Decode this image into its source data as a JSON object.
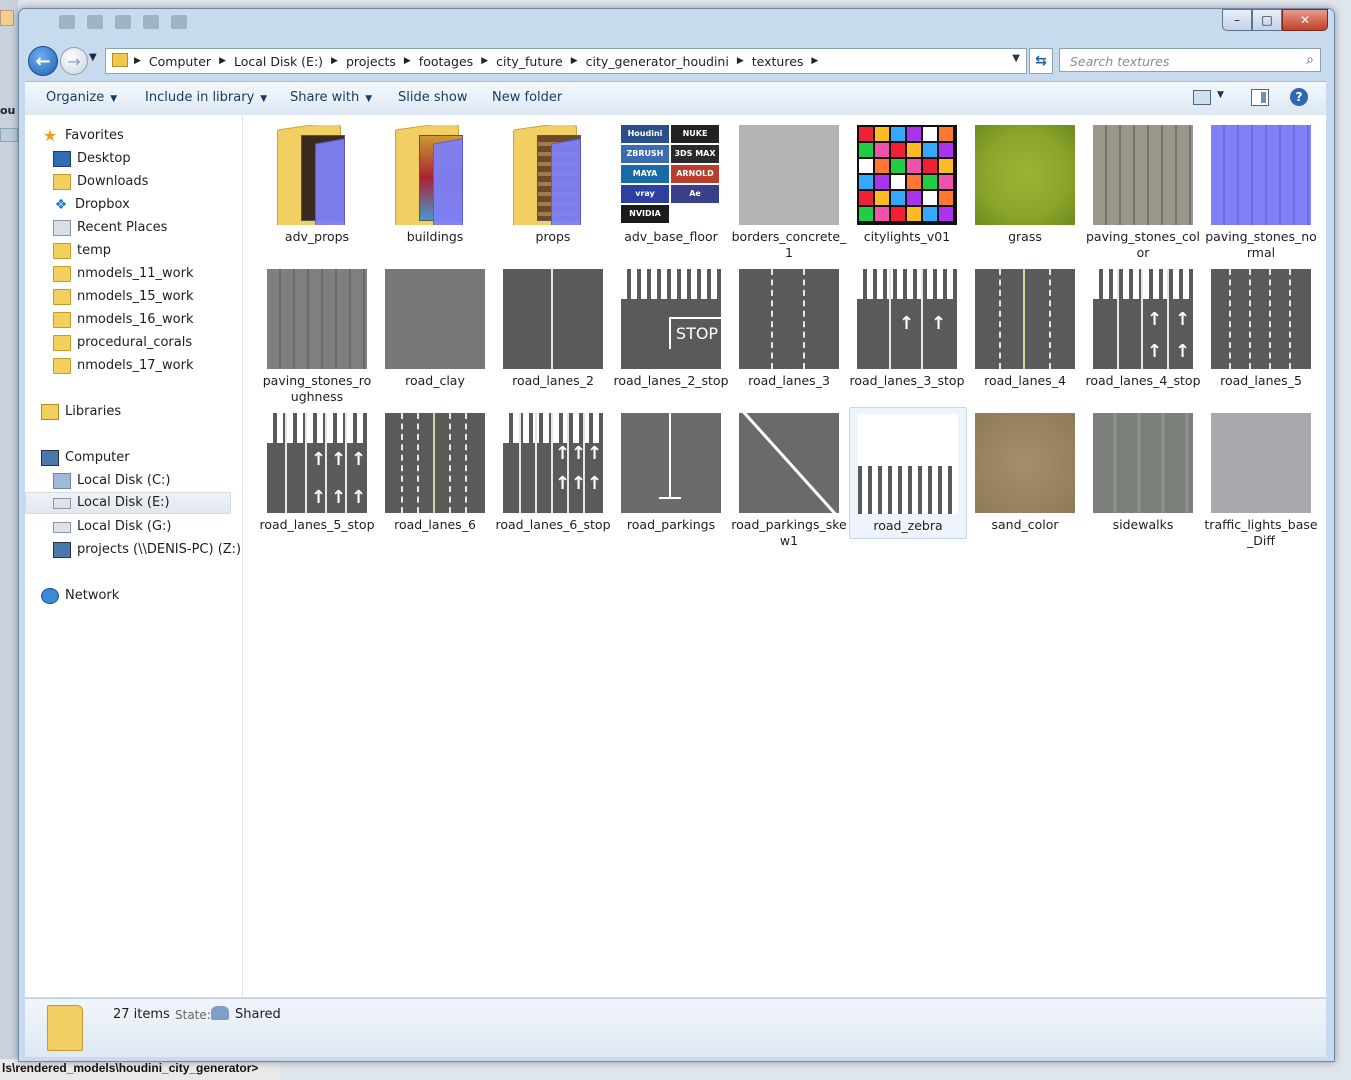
{
  "background": {
    "left_fragment": "ou",
    "bottom_path": "ls\\rendered_models\\houdini_city_generator>"
  },
  "window": {
    "controls": {
      "minimize": "–",
      "maximize": "□",
      "close": "✕"
    }
  },
  "navbar": {
    "back_icon": "←",
    "forward_icon": "→",
    "breadcrumbs": [
      "Computer",
      "Local Disk (E:)",
      "projects",
      "footages",
      "city_future",
      "city_generator_houdini",
      "textures"
    ],
    "search_placeholder": "Search textures",
    "refresh_icon": "⇆"
  },
  "toolbar": {
    "organize": "Organize",
    "include_in_library": "Include in library",
    "share_with": "Share with",
    "slide_show": "Slide show",
    "new_folder": "New folder",
    "help": "?"
  },
  "sidebar": {
    "favorites": {
      "label": "Favorites",
      "items": [
        "Desktop",
        "Downloads",
        "Dropbox",
        "Recent Places",
        "temp",
        "nmodels_11_work",
        "nmodels_15_work",
        "nmodels_16_work",
        "procedural_corals",
        "nmodels_17_work"
      ]
    },
    "libraries": "Libraries",
    "computer": {
      "label": "Computer",
      "items": [
        "Local Disk (C:)",
        "Local Disk (E:)",
        "Local Disk (G:)",
        "projects (\\\\DENIS-PC) (Z:)"
      ],
      "selected": "Local Disk (E:)"
    },
    "network": "Network"
  },
  "files": [
    {
      "name": "adv_props",
      "kind": "folder"
    },
    {
      "name": "buildings",
      "kind": "folder"
    },
    {
      "name": "props",
      "kind": "folder"
    },
    {
      "name": "adv_base_floor",
      "kind": "image"
    },
    {
      "name": "borders_concrete_1",
      "kind": "image"
    },
    {
      "name": "citylights_v01",
      "kind": "image"
    },
    {
      "name": "grass",
      "kind": "image"
    },
    {
      "name": "paving_stones_color",
      "kind": "image"
    },
    {
      "name": "paving_stones_normal",
      "kind": "image"
    },
    {
      "name": "paving_stones_roughness",
      "kind": "image"
    },
    {
      "name": "road_clay",
      "kind": "image"
    },
    {
      "name": "road_lanes_2",
      "kind": "image"
    },
    {
      "name": "road_lanes_2_stop",
      "kind": "image"
    },
    {
      "name": "road_lanes_3",
      "kind": "image"
    },
    {
      "name": "road_lanes_3_stop",
      "kind": "image"
    },
    {
      "name": "road_lanes_4",
      "kind": "image"
    },
    {
      "name": "road_lanes_4_stop",
      "kind": "image"
    },
    {
      "name": "road_lanes_5",
      "kind": "image"
    },
    {
      "name": "road_lanes_5_stop",
      "kind": "image"
    },
    {
      "name": "road_lanes_6",
      "kind": "image"
    },
    {
      "name": "road_lanes_6_stop",
      "kind": "image"
    },
    {
      "name": "road_parkings",
      "kind": "image"
    },
    {
      "name": "road_parkings_skew1",
      "kind": "image"
    },
    {
      "name": "road_zebra",
      "kind": "image",
      "selected": true
    },
    {
      "name": "sand_color",
      "kind": "image"
    },
    {
      "name": "sidewalks",
      "kind": "image"
    },
    {
      "name": "traffic_lights_base_Diff",
      "kind": "image"
    }
  ],
  "thumbnails": {
    "adv_base_floor_logos": [
      "Houdini",
      "NUKE",
      "ZBRUSH",
      "3DS MAX",
      "MAYA",
      "ARNOLD",
      "vray",
      "Ae",
      "NVIDIA"
    ],
    "stop_text": "STOP"
  },
  "status": {
    "items": "27 items",
    "state_label": "State:",
    "state_value": "Shared"
  },
  "colors": {
    "accent": "#1c5fb3",
    "selection": "#edf4fc",
    "window_frame": "#c8dbee",
    "asphalt": "#5a5a5a",
    "grass": "#8aa52a",
    "normal_map": "#7f80f5",
    "sand": "#a68f6a",
    "concrete": "#b4b4b4"
  }
}
